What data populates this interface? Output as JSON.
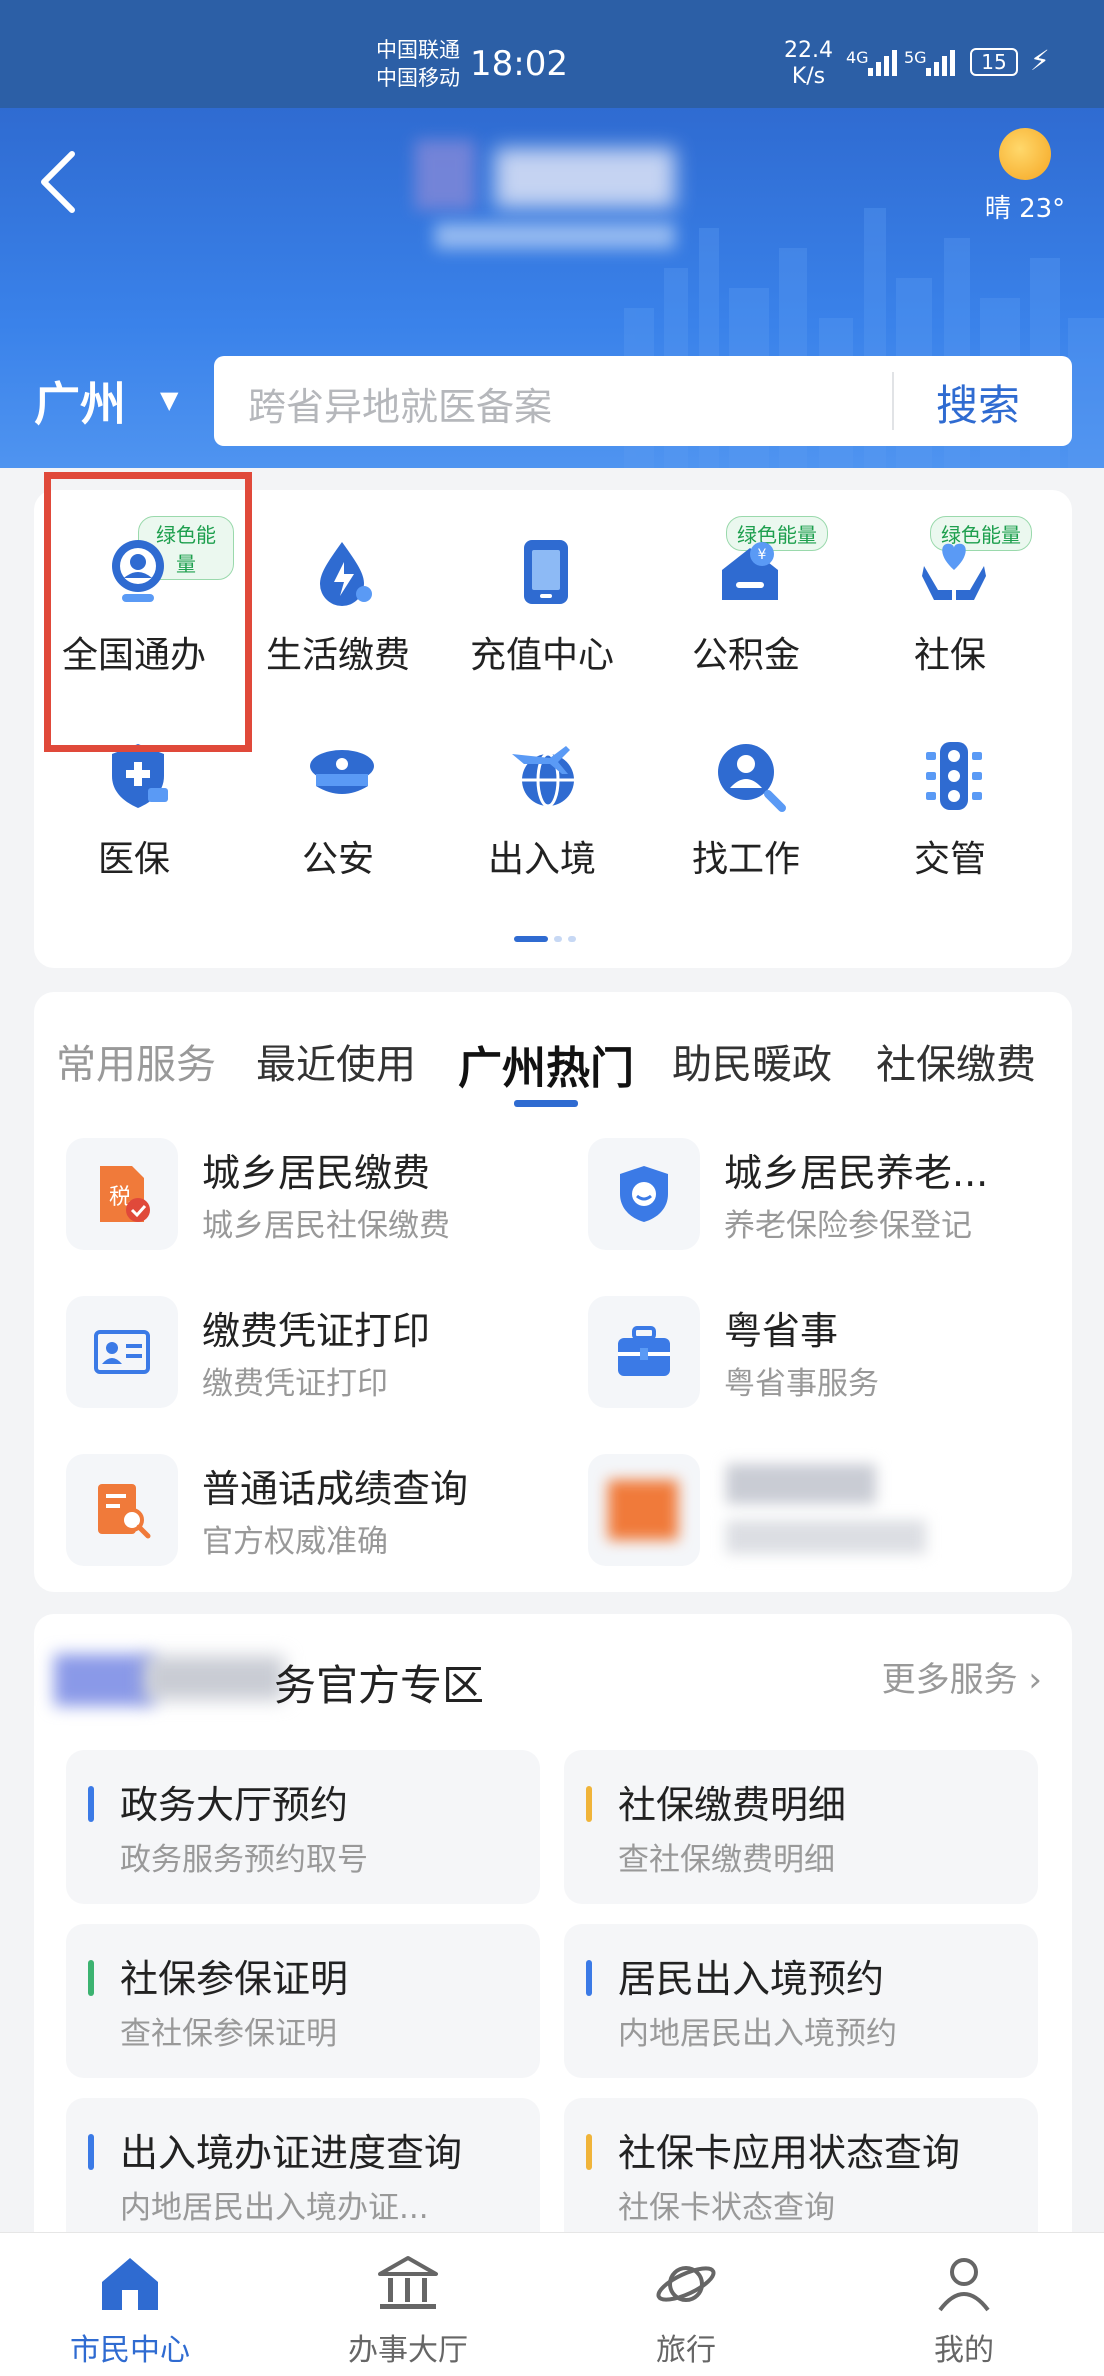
{
  "status_bar": {
    "carrier1": "中国联通",
    "carrier2": "中国移动",
    "time": "18:02",
    "speed_value": "22.4",
    "speed_unit": "K/s",
    "net1": "4G",
    "net2": "5G",
    "battery": "15"
  },
  "header": {
    "weather_text": "晴 23°",
    "city": "广州",
    "search_placeholder": "跨省异地就医备案",
    "search_button": "搜索"
  },
  "grid": {
    "items": [
      {
        "label": "全国通办",
        "icon": "globe-person-icon",
        "badge": "绿色能量"
      },
      {
        "label": "生活缴费",
        "icon": "utility-drop-icon",
        "badge": ""
      },
      {
        "label": "充值中心",
        "icon": "phone-icon",
        "badge": ""
      },
      {
        "label": "公积金",
        "icon": "housing-fund-icon",
        "badge": "绿色能量"
      },
      {
        "label": "社保",
        "icon": "hands-heart-icon",
        "badge": "绿色能量"
      },
      {
        "label": "医保",
        "icon": "medical-shield-icon",
        "badge": ""
      },
      {
        "label": "公安",
        "icon": "police-cap-icon",
        "badge": ""
      },
      {
        "label": "出入境",
        "icon": "plane-globe-icon",
        "badge": ""
      },
      {
        "label": "找工作",
        "icon": "job-search-icon",
        "badge": ""
      },
      {
        "label": "交管",
        "icon": "traffic-light-icon",
        "badge": ""
      }
    ]
  },
  "tabs": {
    "items": [
      "常用服务",
      "最近使用",
      "广州热门",
      "助民暖政",
      "社保缴费"
    ],
    "active": "广州热门"
  },
  "services": [
    {
      "title": "城乡居民缴费",
      "subtitle": "城乡居民社保缴费"
    },
    {
      "title": "城乡居民养老...",
      "subtitle": "养老保险参保登记"
    },
    {
      "title": "缴费凭证打印",
      "subtitle": "缴费凭证打印"
    },
    {
      "title": "粤省事",
      "subtitle": "粤省事服务"
    },
    {
      "title": "普通话成绩查询",
      "subtitle": "官方权威准确"
    }
  ],
  "official": {
    "title": "务官方专区",
    "more": "更多服务",
    "tiles": [
      {
        "title": "政务大厅预约",
        "subtitle": "政务服务预约取号",
        "color": "#3b7ae6"
      },
      {
        "title": "社保缴费明细",
        "subtitle": "查社保缴费明细",
        "color": "#f0b43a"
      },
      {
        "title": "社保参保证明",
        "subtitle": "查社保参保证明",
        "color": "#3cb371"
      },
      {
        "title": "居民出入境预约",
        "subtitle": "内地居民出入境预约",
        "color": "#3b7ae6"
      },
      {
        "title": "出入境办证进度查询",
        "subtitle": "内地居民出入境办证...",
        "color": "#3b7ae6"
      },
      {
        "title": "社保卡应用状态查询",
        "subtitle": "社保卡状态查询",
        "color": "#f0b43a"
      }
    ]
  },
  "bottom_nav": [
    {
      "label": "市民中心",
      "icon": "home-icon"
    },
    {
      "label": "办事大厅",
      "icon": "bank-icon"
    },
    {
      "label": "旅行",
      "icon": "planet-icon"
    },
    {
      "label": "我的",
      "icon": "user-icon"
    }
  ],
  "colors": {
    "primary": "#2f6bd1",
    "highlight": "#e0493a",
    "badge_green": "#1e9f4e"
  }
}
